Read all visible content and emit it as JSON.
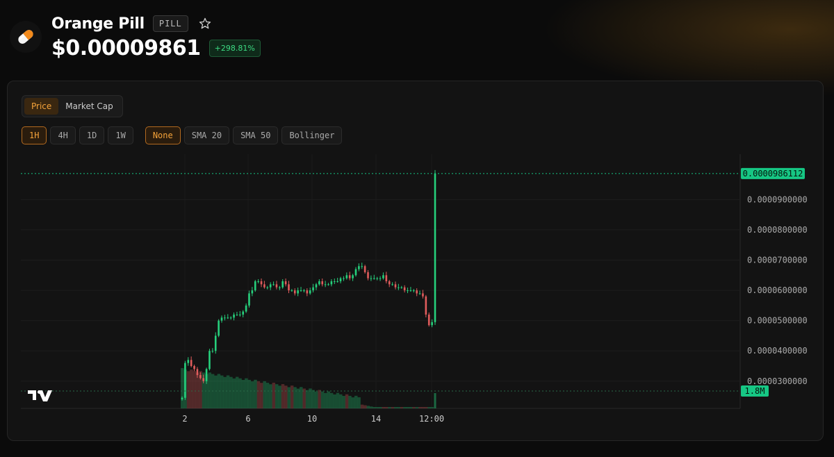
{
  "token": {
    "name": "Orange Pill",
    "symbol": "PILL",
    "price": "$0.00009861",
    "change": "+298.81%",
    "logo_icon": "pill-icon",
    "star_icon": "star-outline-icon"
  },
  "mode_tabs": [
    {
      "label": "Price",
      "active": true
    },
    {
      "label": "Market Cap",
      "active": false
    }
  ],
  "timeframes": [
    {
      "label": "1H",
      "active": true
    },
    {
      "label": "4H",
      "active": false
    },
    {
      "label": "1D",
      "active": false
    },
    {
      "label": "1W",
      "active": false
    }
  ],
  "indicators": [
    {
      "label": "None",
      "active": true
    },
    {
      "label": "SMA 20",
      "active": false
    },
    {
      "label": "SMA 50",
      "active": false
    },
    {
      "label": "Bollinger",
      "active": false
    }
  ],
  "colors": {
    "accent": "#f5a33a",
    "up": "#26d07c",
    "down": "#e05c5c",
    "price_label_bg": "#16c784"
  },
  "chart_data": {
    "type": "candlestick",
    "y_ticks": [
      "0.0000900000",
      "0.0000800000",
      "0.0000700000",
      "0.0000600000",
      "0.0000500000",
      "0.0000400000",
      "0.0000300000"
    ],
    "y_tick_values": [
      9e-05,
      8e-05,
      7e-05,
      6e-05,
      5e-05,
      4e-05,
      3e-05
    ],
    "x_ticks": [
      "2",
      "6",
      "10",
      "14",
      "12:00"
    ],
    "current_price_label": "0.0000986112",
    "current_price": 9.86112e-05,
    "volume_label": "1.8M",
    "ylim": [
      2.1e-05,
      0.000105
    ],
    "close_series": [
      2.45e-05,
      3.6e-05,
      3.7e-05,
      3.5e-05,
      3.4e-05,
      3.2e-05,
      3.1e-05,
      3e-05,
      3.4e-05,
      4e-05,
      4e-05,
      4.5e-05,
      5e-05,
      5.1e-05,
      5.1e-05,
      5.1e-05,
      5.1e-05,
      5.2e-05,
      5.2e-05,
      5.2e-05,
      5.3e-05,
      5.5e-05,
      5.9e-05,
      6e-05,
      6.3e-05,
      6.3e-05,
      6.2e-05,
      6.1e-05,
      6.1e-05,
      6.2e-05,
      6.2e-05,
      6.1e-05,
      6.1e-05,
      6.3e-05,
      6.2e-05,
      6e-05,
      6e-05,
      5.9e-05,
      6e-05,
      6e-05,
      6e-05,
      5.9e-05,
      6e-05,
      6.1e-05,
      6.2e-05,
      6.3e-05,
      6.2e-05,
      6.2e-05,
      6.2e-05,
      6.3e-05,
      6.3e-05,
      6.3e-05,
      6.4e-05,
      6.4e-05,
      6.5e-05,
      6.4e-05,
      6.5e-05,
      6.7e-05,
      6.8e-05,
      6.8e-05,
      6.6e-05,
      6.4e-05,
      6.4e-05,
      6.4e-05,
      6.4e-05,
      6.4e-05,
      6.5e-05,
      6.3e-05,
      6.2e-05,
      6.2e-05,
      6.1e-05,
      6.1e-05,
      6.1e-05,
      6e-05,
      6e-05,
      6e-05,
      6e-05,
      5.9e-05,
      5.9e-05,
      5.8e-05,
      5.2e-05,
      4.85e-05,
      4.95e-05,
      9.86e-05
    ]
  }
}
